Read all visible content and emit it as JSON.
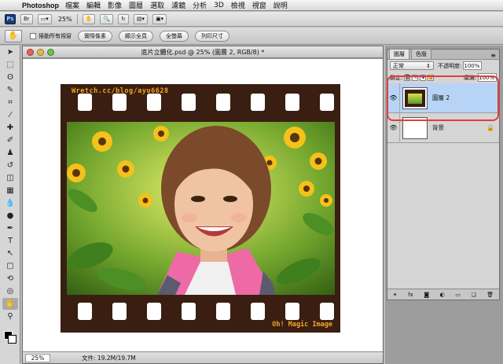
{
  "menubar": {
    "app_name": "Photoshop",
    "items": [
      "檔案",
      "編輯",
      "影像",
      "圖層",
      "選取",
      "濾鏡",
      "分析",
      "3D",
      "檢視",
      "視窗",
      "說明"
    ]
  },
  "appbar": {
    "logo": "Ps",
    "zoom": "25%"
  },
  "optionsbar": {
    "scroll_all_label": "捲動所有視窗",
    "buttons": [
      "實際像素",
      "顯示全頁",
      "全螢幕",
      "列印尺寸"
    ]
  },
  "document": {
    "title": "底片立體化.psd @ 25% (圖層 2, RGB/8) *",
    "status_zoom": "25%",
    "status_info": "文件: 19.2M/19.7M",
    "film_url": "Wretch.cc/blog/ayu6628",
    "film_signature": "Oh! Magic Image"
  },
  "layers_panel": {
    "tabs": [
      "圖層",
      "色版"
    ],
    "blend_mode": "正常",
    "opacity_label": "不透明度:",
    "opacity_value": "100%",
    "lock_label": "鎖定:",
    "fill_label": "填滿:",
    "fill_value": "100%",
    "layers": [
      {
        "name": "圖層 2",
        "selected": true
      },
      {
        "name": "背景",
        "locked": true
      }
    ]
  },
  "colors": {
    "film": "#3a1e12",
    "film_text": "#f5a623",
    "highlight": "#e83a3a",
    "selection": "#b7d4f6"
  }
}
